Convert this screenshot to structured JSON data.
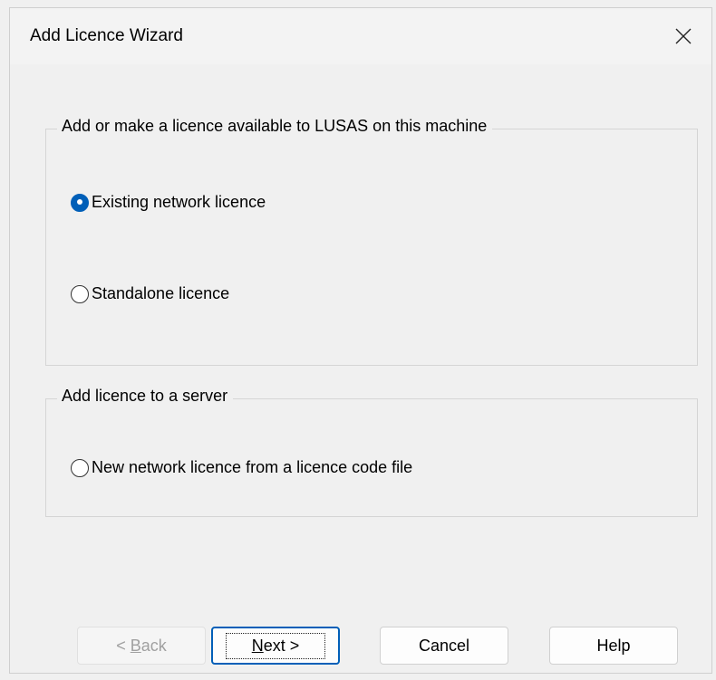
{
  "window": {
    "title": "Add Licence Wizard",
    "close_glyph": "✕"
  },
  "group_machine": {
    "legend": "Add or make a licence available to LUSAS on this machine",
    "options": [
      {
        "label": "Existing network licence",
        "checked": true
      },
      {
        "label": "Standalone licence",
        "checked": false
      }
    ]
  },
  "group_server": {
    "legend": "Add licence to a server",
    "options": [
      {
        "label": "New network licence from a licence code file",
        "checked": false
      }
    ]
  },
  "buttons": {
    "back": {
      "prefix": "< ",
      "mnemonic": "B",
      "rest": "ack",
      "enabled": false
    },
    "next": {
      "mnemonic": "N",
      "rest": "ext >",
      "default": true
    },
    "cancel": "Cancel",
    "help": "Help"
  },
  "colors": {
    "accent": "#005fb8",
    "background": "#f0f0f0"
  }
}
